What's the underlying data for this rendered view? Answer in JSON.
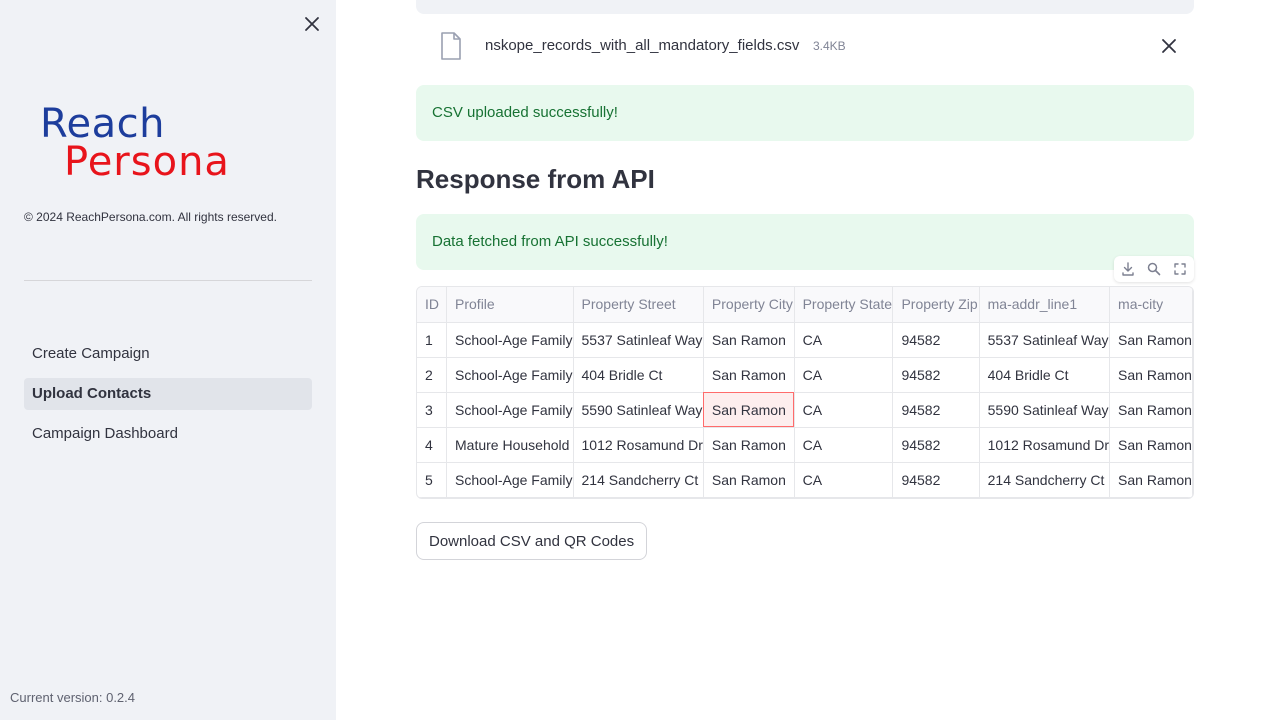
{
  "sidebar": {
    "logo": {
      "line1": "Reach",
      "line2": "Persona"
    },
    "copyright": "© 2024 ReachPersona.com. All rights reserved.",
    "nav": [
      {
        "label": "Create Campaign",
        "active": false
      },
      {
        "label": "Upload Contacts",
        "active": true
      },
      {
        "label": "Campaign Dashboard",
        "active": false
      }
    ],
    "version": "Current version: 0.2.4"
  },
  "upload": {
    "file_name": "nskope_records_with_all_mandatory_fields.csv",
    "file_size": "3.4KB",
    "success_message": "CSV uploaded successfully!"
  },
  "response": {
    "heading": "Response from API",
    "success_message": "Data fetched from API successfully!"
  },
  "table": {
    "columns": [
      "ID",
      "Profile",
      "Property Street",
      "Property City",
      "Property State",
      "Property Zip",
      "ma-addr_line1",
      "ma-city"
    ],
    "rows": [
      [
        "1",
        "School-Age Family",
        "5537 Satinleaf Way",
        "San Ramon",
        "CA",
        "94582",
        "5537 Satinleaf Way",
        "San Ramon"
      ],
      [
        "2",
        "School-Age Family",
        "404 Bridle Ct",
        "San Ramon",
        "CA",
        "94582",
        "404 Bridle Ct",
        "San Ramon"
      ],
      [
        "3",
        "School-Age Family",
        "5590 Satinleaf Way",
        "San Ramon",
        "CA",
        "94582",
        "5590 Satinleaf Way",
        "San Ramon"
      ],
      [
        "4",
        "Mature Household",
        "1012 Rosamund Dr",
        "San Ramon",
        "CA",
        "94582",
        "1012 Rosamund Dr",
        "San Ramon"
      ],
      [
        "5",
        "School-Age Family",
        "214 Sandcherry Ct",
        "San Ramon",
        "CA",
        "94582",
        "214 Sandcherry Ct",
        "San Ramon"
      ]
    ],
    "selected_cell": {
      "row": 3,
      "column": "Property City"
    }
  },
  "actions": {
    "download_label": "Download CSV and QR Codes"
  },
  "icons": [
    "close-icon",
    "file-icon",
    "remove-file-icon",
    "download-icon",
    "search-icon",
    "fullscreen-icon"
  ],
  "colors": {
    "sidebar_bg": "#f0f2f6",
    "success_bg": "#e8f9ee",
    "success_text": "#177233",
    "logo_blue": "#1d3d9c",
    "logo_red": "#e8141b",
    "selection_border": "#ff6b6b"
  }
}
